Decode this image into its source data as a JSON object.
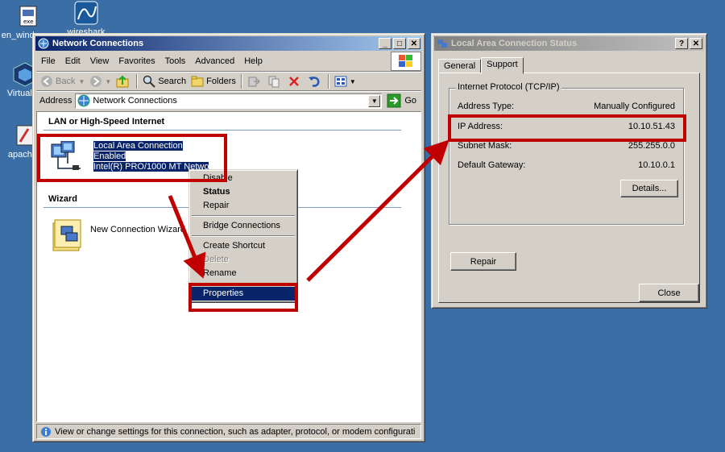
{
  "desktop": {
    "icons": [
      {
        "label": "en_windows",
        "icon": "installer-icon"
      },
      {
        "label": "wireshark",
        "icon": "wireshark-icon"
      },
      {
        "label": "VirtualBo",
        "icon": "virtualbox-icon"
      },
      {
        "label": "apache_",
        "icon": "apache-icon"
      }
    ]
  },
  "network_window": {
    "title": "Network Connections",
    "menu": [
      "File",
      "Edit",
      "View",
      "Favorites",
      "Tools",
      "Advanced",
      "Help"
    ],
    "toolbar": {
      "back": "Back",
      "search": "Search",
      "folders": "Folders"
    },
    "address_label": "Address",
    "address_value": "Network Connections",
    "go_label": "Go",
    "groups": {
      "lan_title": "LAN or High-Speed Internet",
      "wizard_title": "Wizard"
    },
    "lan_item": {
      "name": "Local Area Connection",
      "status": "Enabled",
      "adapter": "Intel(R) PRO/1000 MT Netwo"
    },
    "wizard_item": {
      "name": "New Connection Wizard"
    },
    "status_bar": "View or change settings for this connection, such as adapter, protocol, or modem configurati"
  },
  "context_menu": {
    "items": [
      {
        "label": "Disable"
      },
      {
        "label": "Status"
      },
      {
        "label": "Repair"
      },
      {
        "label": "Bridge Connections"
      },
      {
        "label": "Create Shortcut"
      },
      {
        "label": "Delete"
      },
      {
        "label": "Rename"
      },
      {
        "label": "Properties"
      }
    ]
  },
  "status_dialog": {
    "title": "Local Area Connection Status",
    "tabs": [
      "General",
      "Support"
    ],
    "group_title": "Internet Protocol (TCP/IP)",
    "rows": [
      {
        "label": "Address Type:",
        "value": "Manually Configured"
      },
      {
        "label": "IP Address:",
        "value": "10.10.51.43"
      },
      {
        "label": "Subnet Mask:",
        "value": "255.255.0.0"
      },
      {
        "label": "Default Gateway:",
        "value": "10.10.0.1"
      }
    ],
    "details_button": "Details...",
    "repair_button": "Repair",
    "close_button": "Close"
  },
  "colors": {
    "desktop": "#3a6ea5",
    "title_active": "#0a246a",
    "annotation_red": "#c00000",
    "selection": "#0a246a"
  }
}
